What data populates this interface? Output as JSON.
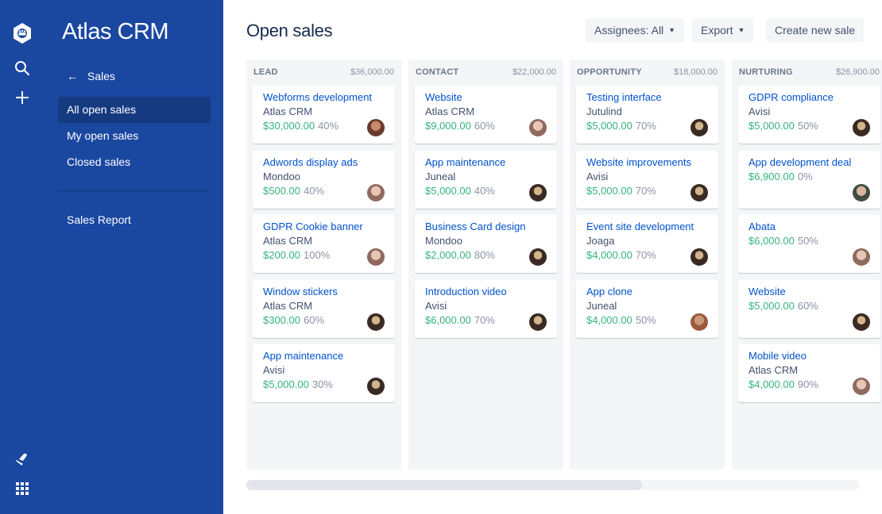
{
  "app": {
    "name": "Atlas CRM",
    "global_nav": {
      "icons": [
        "logo-icon",
        "search-icon",
        "create-icon",
        "notifications-icon",
        "app-switcher-icon"
      ]
    }
  },
  "sidebar": {
    "back_label": "Sales",
    "items": [
      {
        "label": "All open sales",
        "active": true
      },
      {
        "label": "My open sales",
        "active": false
      },
      {
        "label": "Closed sales",
        "active": false
      }
    ],
    "report_label": "Sales Report"
  },
  "header": {
    "title": "Open sales",
    "assignees_label": "Assignees: All",
    "export_label": "Export",
    "create_label": "Create new sale"
  },
  "colors": {
    "nav_bg": "#1a47a0",
    "active_item_bg": "#153a80",
    "link": "#0052cc",
    "amount": "#36b37e"
  },
  "columns": [
    {
      "name": "LEAD",
      "total": "$36,000.00",
      "cards": [
        {
          "title": "Webforms development",
          "company": "Atlas CRM",
          "amount": "$30,000.00",
          "probability": "40%",
          "avatar": "a"
        },
        {
          "title": "Adwords display ads",
          "company": "Mondoo",
          "amount": "$500.00",
          "probability": "40%",
          "avatar": "b"
        },
        {
          "title": "GDPR Cookie banner",
          "company": "Atlas CRM",
          "amount": "$200.00",
          "probability": "100%",
          "avatar": "b"
        },
        {
          "title": "Window stickers",
          "company": "Atlas CRM",
          "amount": "$300.00",
          "probability": "60%",
          "avatar": "c"
        },
        {
          "title": "App maintenance",
          "company": "Avisi",
          "amount": "$5,000.00",
          "probability": "30%",
          "avatar": "c"
        }
      ]
    },
    {
      "name": "CONTACT",
      "total": "$22,000.00",
      "cards": [
        {
          "title": "Website",
          "company": "Atlas CRM",
          "amount": "$9,000.00",
          "probability": "60%",
          "avatar": "b"
        },
        {
          "title": "App maintenance",
          "company": "Juneal",
          "amount": "$5,000.00",
          "probability": "40%",
          "avatar": "c"
        },
        {
          "title": "Business Card design",
          "company": "Mondoo",
          "amount": "$2,000.00",
          "probability": "80%",
          "avatar": "c"
        },
        {
          "title": "Introduction video",
          "company": "Avisi",
          "amount": "$6,000.00",
          "probability": "70%",
          "avatar": "c"
        }
      ]
    },
    {
      "name": "OPPORTUNITY",
      "total": "$18,000.00",
      "cards": [
        {
          "title": "Testing interface",
          "company": "Jutulind",
          "amount": "$5,000.00",
          "probability": "70%",
          "avatar": "c"
        },
        {
          "title": "Website improvements",
          "company": "Avisi",
          "amount": "$5,000.00",
          "probability": "70%",
          "avatar": "c"
        },
        {
          "title": "Event site development",
          "company": "Joaga",
          "amount": "$4,000.00",
          "probability": "70%",
          "avatar": "c"
        },
        {
          "title": "App clone",
          "company": "Juneal",
          "amount": "$4,000.00",
          "probability": "50%",
          "avatar": "d"
        }
      ]
    },
    {
      "name": "NURTURING",
      "total": "$26,900.00",
      "cards": [
        {
          "title": "GDPR compliance",
          "company": "Avisi",
          "amount": "$5,000.00",
          "probability": "50%",
          "avatar": "c"
        },
        {
          "title": "App development deal",
          "company": "",
          "amount": "$6,900.00",
          "probability": "0%",
          "avatar": "e"
        },
        {
          "title": "Abata",
          "company": "",
          "amount": "$6,000.00",
          "probability": "50%",
          "avatar": "b"
        },
        {
          "title": "Website",
          "company": "",
          "amount": "$5,000.00",
          "probability": "60%",
          "avatar": "c"
        },
        {
          "title": "Mobile video",
          "company": "Atlas CRM",
          "amount": "$4,000.00",
          "probability": "90%",
          "avatar": "b"
        }
      ]
    }
  ],
  "scroll": {
    "horizontal_position": 0
  }
}
